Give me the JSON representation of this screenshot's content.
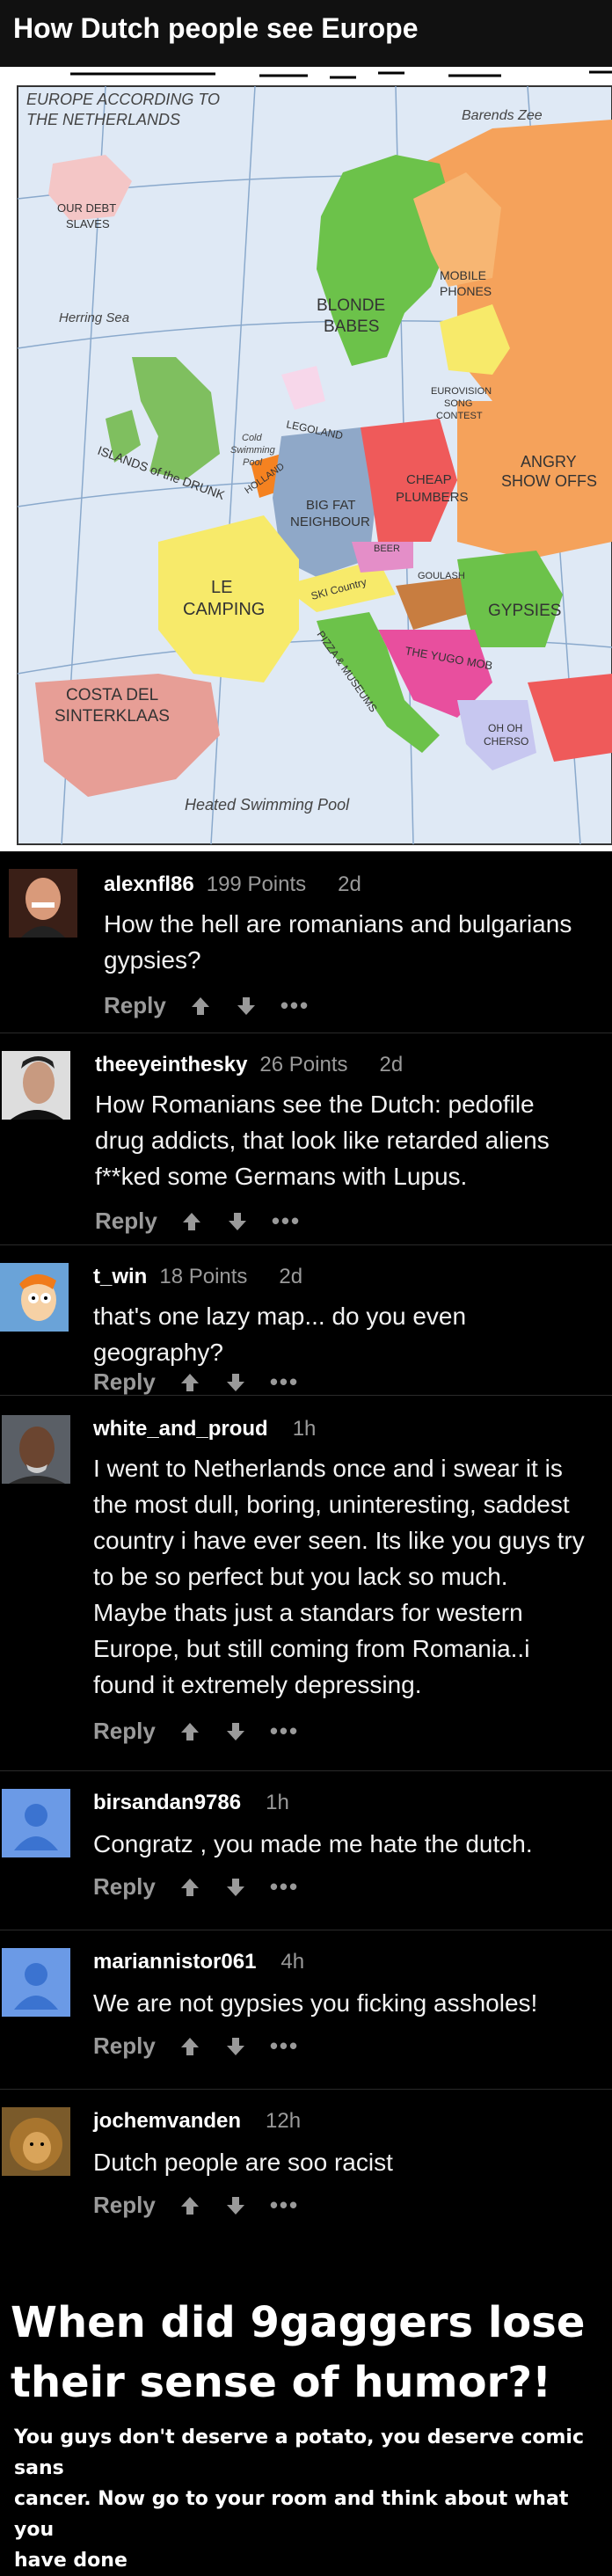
{
  "post": {
    "title": "How Dutch people see Europe"
  },
  "map": {
    "heading_line1": "EUROPE ACCORDING TO",
    "heading_line2": "THE NETHERLANDS",
    "labels": {
      "barents": "Barends Zee",
      "debt1": "OUR DEBT",
      "debt2": "SLAVES",
      "herring": "Herring Sea",
      "mobile1": "MOBILE",
      "mobile2": "PHONES",
      "blonde1": "BLONDE",
      "blonde2": "BABES",
      "euro1": "EUROVISION",
      "euro2": "SONG",
      "euro3": "CONTEST",
      "legoland": "LEGOLAND",
      "cold1": "Cold",
      "cold2": "Swimming",
      "cold3": "Pool",
      "drunk": "ISLANDS of the DRUNK",
      "holland": "HOLLAND",
      "plumbers1": "CHEAP",
      "plumbers2": "PLUMBERS",
      "angry1": "ANGRY",
      "angry2": "SHOW OFFS",
      "neighbour1": "BIG FAT",
      "neighbour2": "NEIGHBOUR",
      "beer": "BEER",
      "goulash": "GOULASH",
      "camping1": "LE",
      "camping2": "CAMPING",
      "ski": "SKI Country",
      "gypsies": "GYPSIES",
      "pizza": "PIZZA & MUSEUMS",
      "yugo": "THE YUGO MOB",
      "sinterklaas1": "COSTA DEL",
      "sinterklaas2": "SINTERKLAAS",
      "ohoh1": "OH OH",
      "ohoh2": "CHERSO",
      "heated": "Heated Swimming Pool"
    }
  },
  "comments": [
    {
      "username": "alexnfl86",
      "points": "199 Points",
      "time": "2d",
      "text_lines": [
        "How the hell are romanians and bulgarians",
        "gypsies?"
      ],
      "avatar": "man-grin-avatar"
    },
    {
      "username": "theeyeinthesky",
      "points": "26 Points",
      "time": "2d",
      "text_lines": [
        "How Romanians see the Dutch: pedofile",
        "drug addicts, that look like retarded aliens",
        "f**ked some Germans with Lupus."
      ],
      "avatar": "man-portrait-avatar"
    },
    {
      "username": "t_win",
      "points": "18 Points",
      "time": "2d",
      "text_lines": [
        "that's one lazy map... do you even",
        "geography?"
      ],
      "avatar": "cartoon-fry-avatar"
    },
    {
      "username": "white_and_proud",
      "points": "",
      "time": "1h",
      "text_lines": [
        "I went to Netherlands once and i swear it is",
        "the most dull, boring, uninteresting, saddest",
        "country i have ever seen. Its like you guys try",
        "to be so perfect but you lack so much.",
        "Maybe thats just a standars for western",
        "Europe, but still coming from Romania..i",
        "found it extremely depressing."
      ],
      "avatar": "man-photo-avatar"
    },
    {
      "username": "birsandan9786",
      "points": "",
      "time": "1h",
      "text_lines": [
        "Congratz , you made me hate the dutch."
      ],
      "avatar": "default-user-avatar"
    },
    {
      "username": "mariannistor061",
      "points": "",
      "time": "4h",
      "text_lines": [
        "We are not gypsies you ficking assholes!"
      ],
      "avatar": "default-user-avatar"
    },
    {
      "username": "jochemvanden",
      "points": "",
      "time": "12h",
      "text_lines": [
        "Dutch people are soo racist"
      ],
      "avatar": "lion-avatar"
    }
  ],
  "actions": {
    "reply": "Reply",
    "more": "•••"
  },
  "footer": {
    "title_line1": "When did 9gaggers lose",
    "title_line2": "their sense of humor?!",
    "sub_line1": "You guys don't deserve a potato, you deserve comic sans",
    "sub_line2": "cancer. Now go to your room and think about what you",
    "sub_line3": "have done"
  },
  "colors": {
    "background": "#000000",
    "text": "#ffffff",
    "muted": "#9a9a9a",
    "default_avatar": "#6b9ae6"
  }
}
